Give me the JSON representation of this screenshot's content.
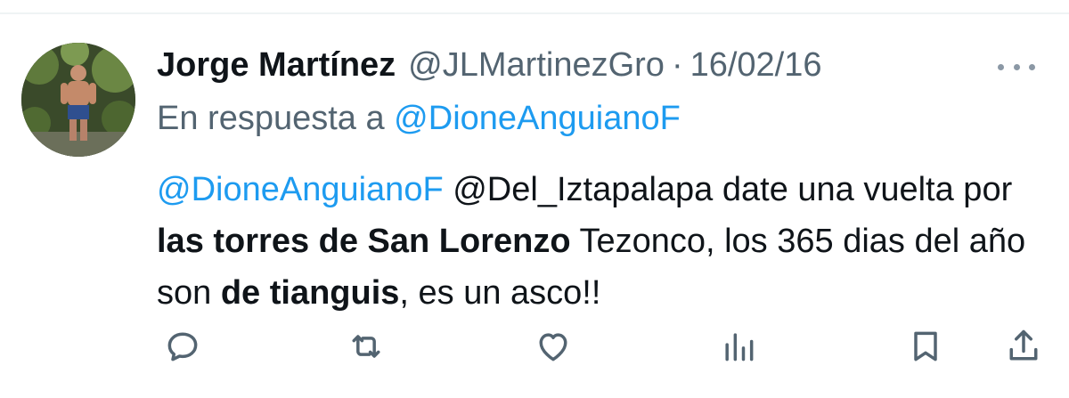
{
  "tweet": {
    "display_name": "Jorge Martínez",
    "handle": "@JLMartinezGro",
    "separator": "·",
    "date": "16/02/16",
    "reply_prefix": "En respuesta a",
    "reply_to": "@DioneAnguianoF",
    "body": {
      "mention_1": "@DioneAnguianoF",
      "text_1": " @Del_Iztapalapa date una vuelta por ",
      "bold_1": "las torres de San Lorenzo",
      "text_2": " Tezonco, los 365 dias del año son ",
      "bold_2": "de tianguis",
      "text_3": ", es un asco!!"
    }
  },
  "actions": {
    "icons": [
      "reply-icon",
      "retweet-icon",
      "like-icon",
      "views-icon",
      "bookmark-icon",
      "share-icon"
    ]
  },
  "colors": {
    "text": "#0f1419",
    "secondary": "#536471",
    "link": "#1d9bf0",
    "divider": "#eff3f4"
  }
}
